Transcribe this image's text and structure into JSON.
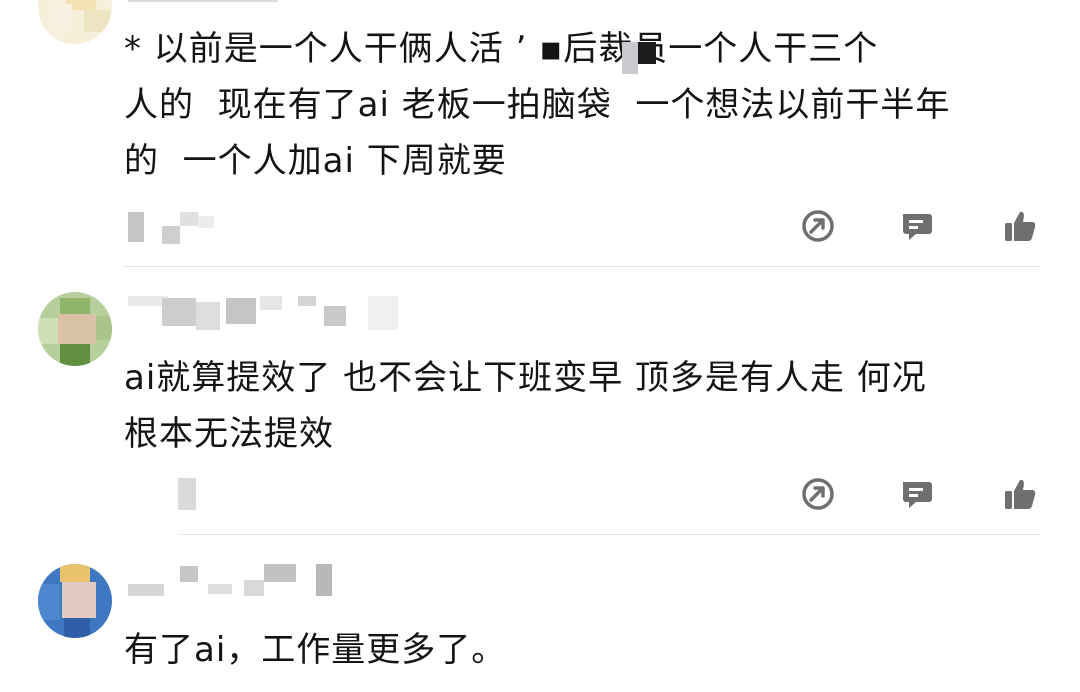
{
  "comments": [
    {
      "text": "* 以前是一个人干俩人活 ’ ▪后裁员一个人干三个\n人的  现在有了ai 老板一拍脑袋  一个想法以前干半年\n的  一个人加ai 下周就要"
    },
    {
      "text": "ai就算提效了 也不会让下班变早 顶多是有人走 何况\n根本无法提效"
    },
    {
      "text": "有了ai，工作量更多了。"
    }
  ],
  "actions": {
    "share_icon": "share-arrow-icon",
    "reply_icon": "comment-bubble-icon",
    "like_icon": "thumbs-up-icon"
  },
  "colors": {
    "text": "#141414",
    "icon": "#6f6f6f",
    "divider": "#e4e4e4"
  }
}
